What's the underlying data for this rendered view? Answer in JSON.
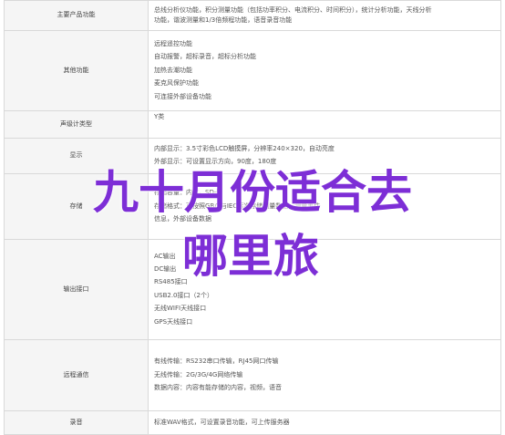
{
  "rows": [
    {
      "label": "主要产品功能",
      "lines": [
        "总线分析仪功能，积分测量功能（包括功率积分、电流积分、时间积分），统计分析功能，天线分析",
        "功能，谐波测量和1/3倍频程功能，语音录音功能"
      ]
    },
    {
      "label": "其他功能",
      "lines": [
        "远程遥控功能",
        "自动报警，超标录音，超标分析功能",
        "加热去潮功能",
        "麦克风保护功能",
        "可连接外部设备功能"
      ]
    },
    {
      "label": "声级计类型",
      "lines": [
        "Y类"
      ]
    },
    {
      "label": "显示",
      "lines": [
        "内部显示：3.5寸彩色LCD触摸屏，分辨率240×320，自动亮度",
        "外部显示：可设置显示方向，90度，180度"
      ]
    },
    {
      "label": "存储",
      "lines": [
        "存储容量：内存，SD卡",
        "存储格式：可按照GB/T与IEC标准存储测量数据，测量事件",
        "信息，外部设备数据"
      ]
    },
    {
      "label": "输出接口",
      "lines": [
        "AC输出",
        "DC输出",
        "RS485接口",
        "USB2.0接口（2个）",
        "无线WIFI天线接口",
        "GPS天线接口"
      ]
    },
    {
      "label": "远程通信",
      "lines": [
        "有线传输：RS232串口传输，RJ45网口传输",
        "无线传输：2G/3G/4G网络传输",
        "数据内容：内容有能存储的内容，视频，语音"
      ]
    },
    {
      "label": "录音",
      "lines": [
        "标准WAV格式，可设置录音功能，可上传服务器"
      ]
    }
  ],
  "overlay": {
    "line1": "九十月份适合去",
    "line2": "哪里旅"
  }
}
